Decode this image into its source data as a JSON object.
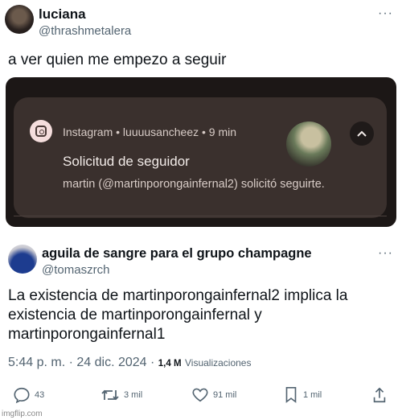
{
  "tweet1": {
    "name": "luciana",
    "handle": "@thrashmetalera",
    "more": "···",
    "text": "a ver quien me empezo a seguir",
    "notification": {
      "app_meta": "Instagram • luuuusancheez • 9 min",
      "title": "Solicitud de seguidor",
      "body": "martin (@martinporongainfernal2) solicitó seguirte.",
      "collapse_icon": "^"
    }
  },
  "tweet2": {
    "name": "aguila de sangre para el grupo champagne",
    "handle": "@tomaszrch",
    "more": "···",
    "text": "La existencia de martinporongainfernal2 implica la existencia de martinporongainfernal y martinporongainfernal1",
    "timestamp": "5:44 p. m. · 24 dic. 2024 · ",
    "views_count": "1,4 M",
    "views_label": "Visualizaciones",
    "actions": {
      "replies": "43",
      "retweets": "3 mil",
      "likes": "91 mil",
      "bookmarks": "1 mil"
    }
  },
  "watermark": "imgflip.com",
  "colors": {
    "text": "#0f1419",
    "secondary": "#536471",
    "notification_bg": "#3a302d",
    "phone_bg": "#1c1716"
  }
}
